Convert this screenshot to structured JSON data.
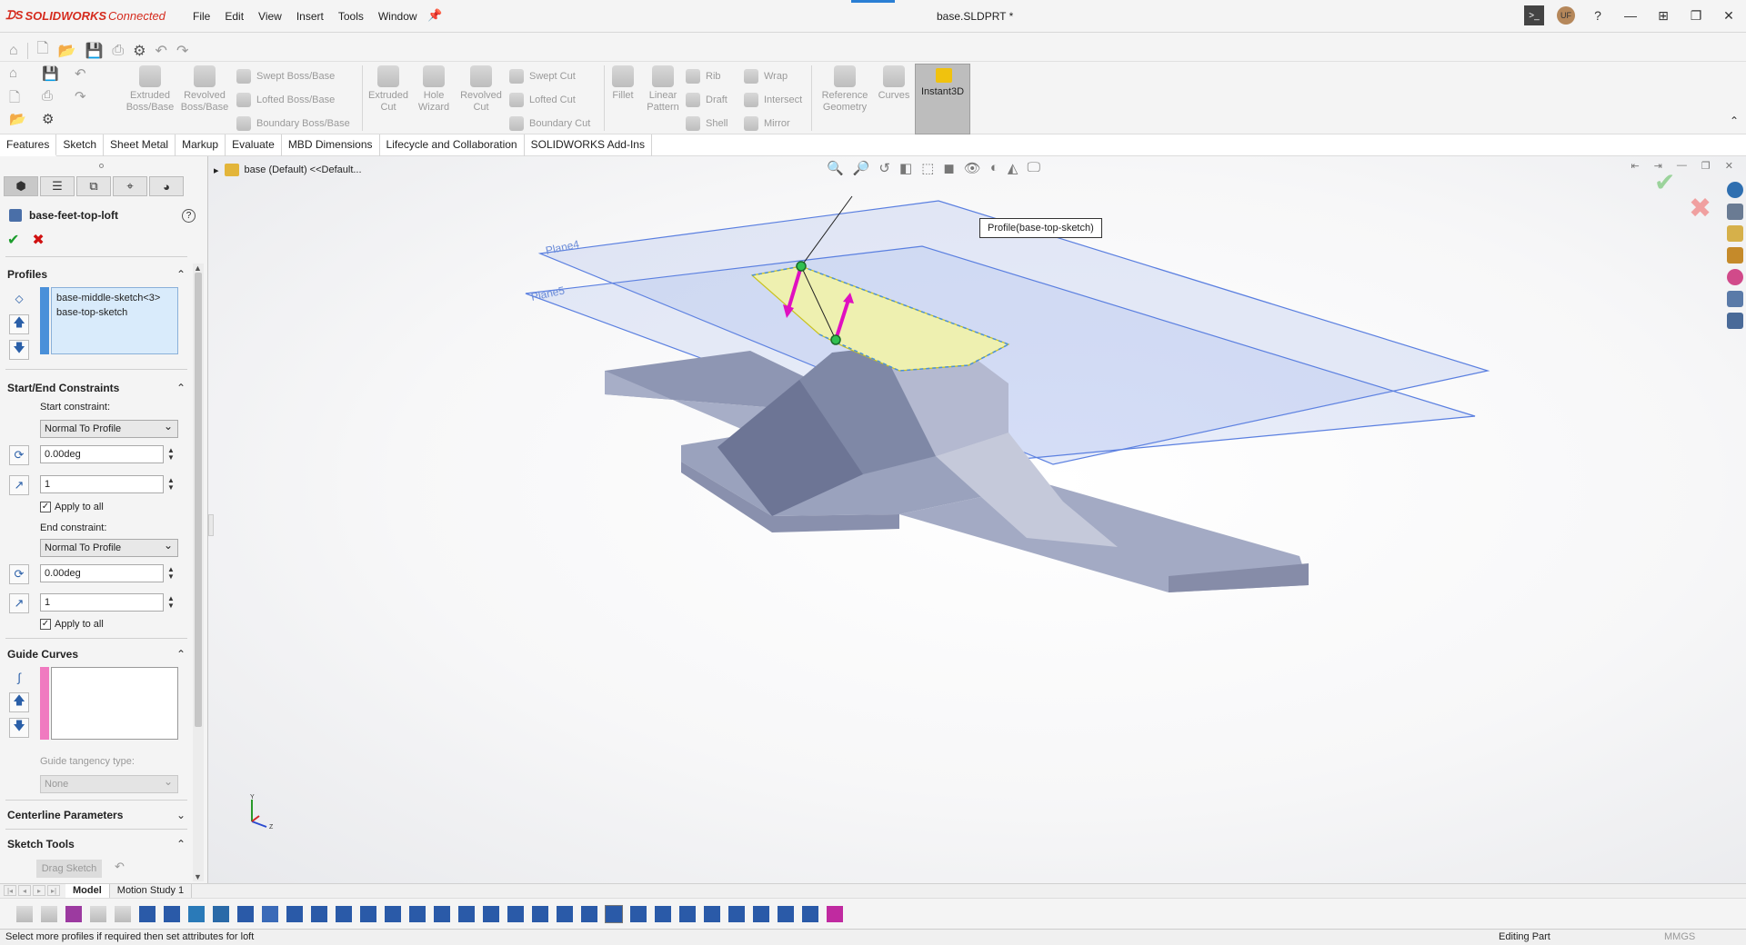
{
  "app": {
    "brand": "SOLIDWORKS",
    "brand_suffix": "Connected",
    "document_title": "base.SLDPRT *",
    "user_initials": "UF"
  },
  "menu": [
    "File",
    "Edit",
    "View",
    "Insert",
    "Tools",
    "Window"
  ],
  "ribbon": {
    "buttons": [
      {
        "label": "Extruded Boss/Base"
      },
      {
        "label": "Revolved Boss/Base"
      },
      {
        "label": "Extruded Cut"
      },
      {
        "label": "Hole Wizard"
      },
      {
        "label": "Revolved Cut"
      },
      {
        "label": "Fillet"
      },
      {
        "label": "Linear Pattern"
      },
      {
        "label": "Reference Geometry"
      },
      {
        "label": "Curves"
      }
    ],
    "small_buttons": {
      "swept_boss": "Swept Boss/Base",
      "lofted_boss": "Lofted Boss/Base",
      "boundary_boss": "Boundary Boss/Base",
      "swept_cut": "Swept Cut",
      "lofted_cut": "Lofted Cut",
      "boundary_cut": "Boundary Cut",
      "rib": "Rib",
      "draft": "Draft",
      "shell": "Shell",
      "wrap": "Wrap",
      "intersect": "Intersect",
      "mirror": "Mirror"
    },
    "instant3d": "Instant3D"
  },
  "tabs": [
    {
      "label": "Features",
      "active": true
    },
    {
      "label": "Sketch"
    },
    {
      "label": "Sheet Metal"
    },
    {
      "label": "Markup"
    },
    {
      "label": "Evaluate"
    },
    {
      "label": "MBD Dimensions"
    },
    {
      "label": "Lifecycle and Collaboration"
    },
    {
      "label": "SOLIDWORKS Add-Ins"
    }
  ],
  "property_manager": {
    "feature_name": "base-feet-top-loft",
    "profiles": {
      "header": "Profiles",
      "items": [
        "base-middle-sketch<3>",
        "base-top-sketch"
      ]
    },
    "constraints": {
      "header": "Start/End Constraints",
      "start_label": "Start constraint:",
      "start_value": "Normal To Profile",
      "start_angle": "0.00deg",
      "start_length": "1",
      "start_apply_all": "Apply to all",
      "end_label": "End constraint:",
      "end_value": "Normal To Profile",
      "end_angle": "0.00deg",
      "end_length": "1",
      "end_apply_all": "Apply to all"
    },
    "guide_curves": {
      "header": "Guide Curves",
      "tangency_label": "Guide tangency type:",
      "tangency_value": "None"
    },
    "centerline": {
      "header": "Centerline Parameters"
    },
    "sketch_tools": {
      "header": "Sketch Tools",
      "drag_sketch": "Drag Sketch"
    }
  },
  "viewport": {
    "tree_crumb": "base (Default) <<Default...",
    "callout": "Profile(base-top-sketch)",
    "plane_labels": [
      "Plane4",
      "Plane5"
    ],
    "triad": {
      "x": "X",
      "y": "Y",
      "z": "Z"
    }
  },
  "bottom_tabs": [
    {
      "label": "Model",
      "active": true
    },
    {
      "label": "Motion Study 1"
    }
  ],
  "status": {
    "message": "Select more profiles if required then set attributes for loft",
    "mode": "Editing Part",
    "units": "MMGS"
  },
  "colors": {
    "brand_red": "#d52b1e",
    "selection_blue": "#d9ebfb",
    "guide_pink": "#f07ac0",
    "profile_blue": "#4a90d9",
    "model_gray": "#9aa2bd",
    "connector_magenta": "#e010c0"
  }
}
